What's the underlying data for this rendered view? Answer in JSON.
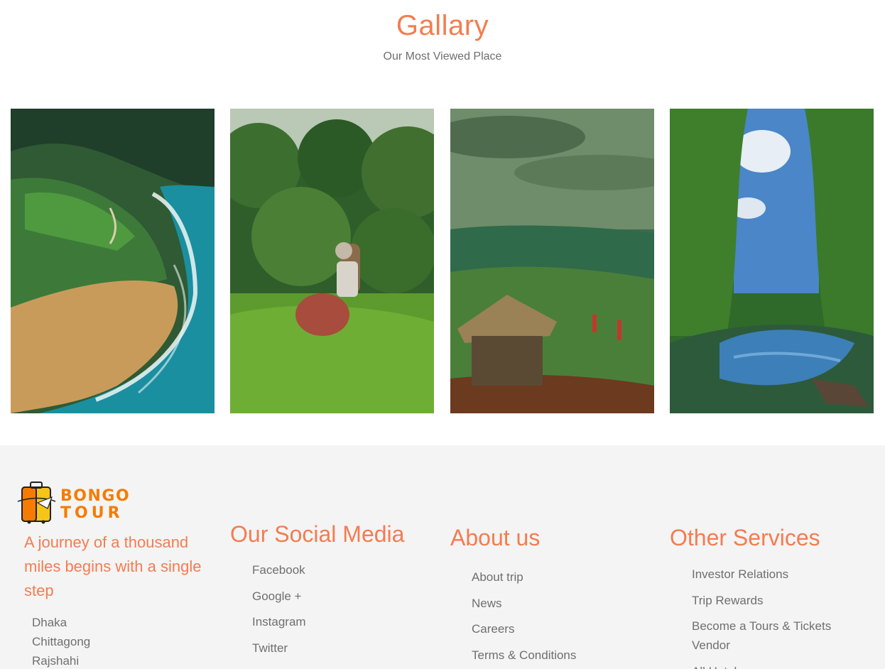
{
  "gallery": {
    "title": "Gallary",
    "subtitle": "Our Most Viewed Place"
  },
  "footer": {
    "logo": {
      "line1": "BONGO",
      "line2": "TOUR"
    },
    "tagline": "A journey of a thousand miles begins with a single step",
    "cities": [
      "Dhaka",
      "Chittagong",
      "Rajshahi"
    ],
    "social": {
      "title": "Our Social Media",
      "links": [
        "Facebook",
        "Google +",
        "Instagram",
        "Twitter"
      ]
    },
    "about": {
      "title": "About us",
      "links": [
        "About trip",
        "News",
        "Careers",
        "Terms & Conditions"
      ]
    },
    "services": {
      "title": "Other Services",
      "links": [
        "Investor Relations",
        "Trip Rewards",
        "Become a Tours & Tickets Vendor",
        "All Hotels"
      ]
    }
  },
  "colors": {
    "accent": "#f47c50",
    "logo_orange": "#f57c00",
    "footer_bg": "#f4f4f4",
    "text_gray": "#6f6f6f"
  }
}
